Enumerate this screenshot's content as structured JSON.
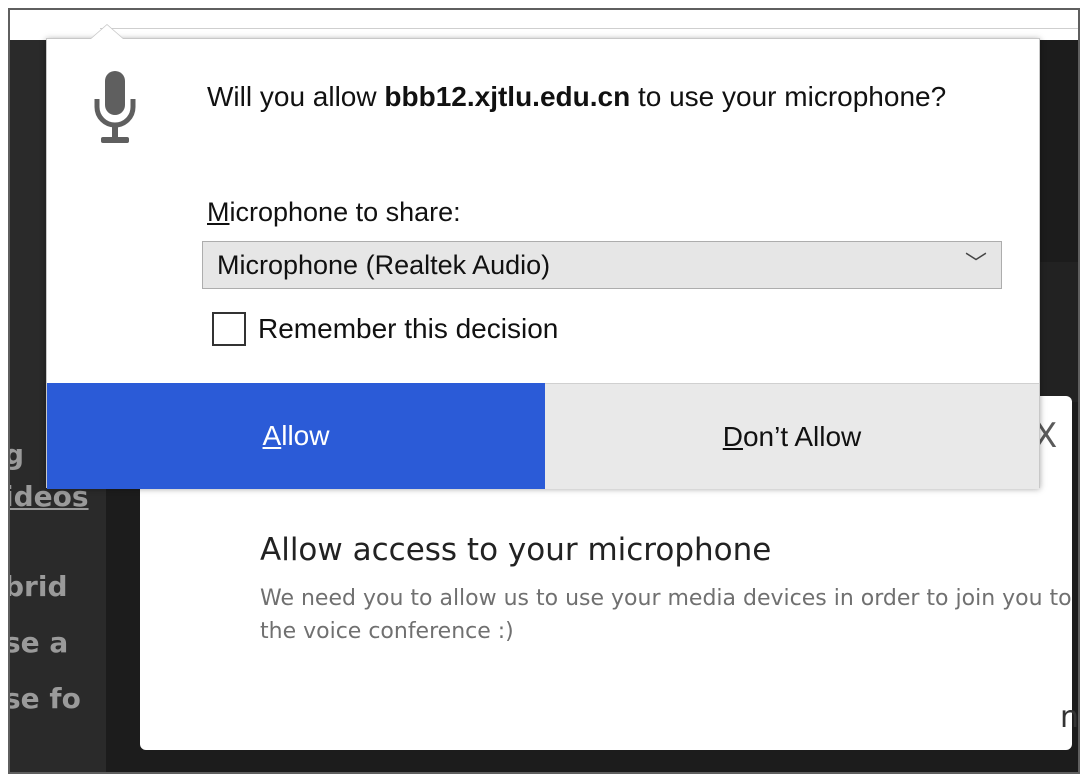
{
  "prompt": {
    "prefix": "Will you allow ",
    "site": "bbb12.xjtlu.edu.cn",
    "suffix": " to use your microphone?"
  },
  "microphone_select": {
    "label_access_key": "M",
    "label_rest": "icrophone to share:",
    "selected_value": "Microphone (Realtek Audio)"
  },
  "remember": {
    "label": "Remember this decision",
    "checked": false
  },
  "buttons": {
    "allow_key": "A",
    "allow_rest": "llow",
    "deny_key": "D",
    "deny_rest": "on’t Allow"
  },
  "modal": {
    "close_symbol": "X",
    "title": "Allow access to your microphone",
    "description": "We need you to allow us to use your media devices in order to join you to the voice conference :)",
    "right_edge_glyph": "n"
  },
  "background_fragments": {
    "line1": "g",
    "line2": "ideos",
    "line3": "brid",
    "line4": "se a",
    "line5": "se fo"
  },
  "colors": {
    "allow_button": "#2b5bd7",
    "deny_button": "#e9e9e9",
    "page_background": "#1c1c1c"
  },
  "icons": {
    "microphone": "microphone-icon",
    "dropdown": "chevron-down-icon"
  }
}
